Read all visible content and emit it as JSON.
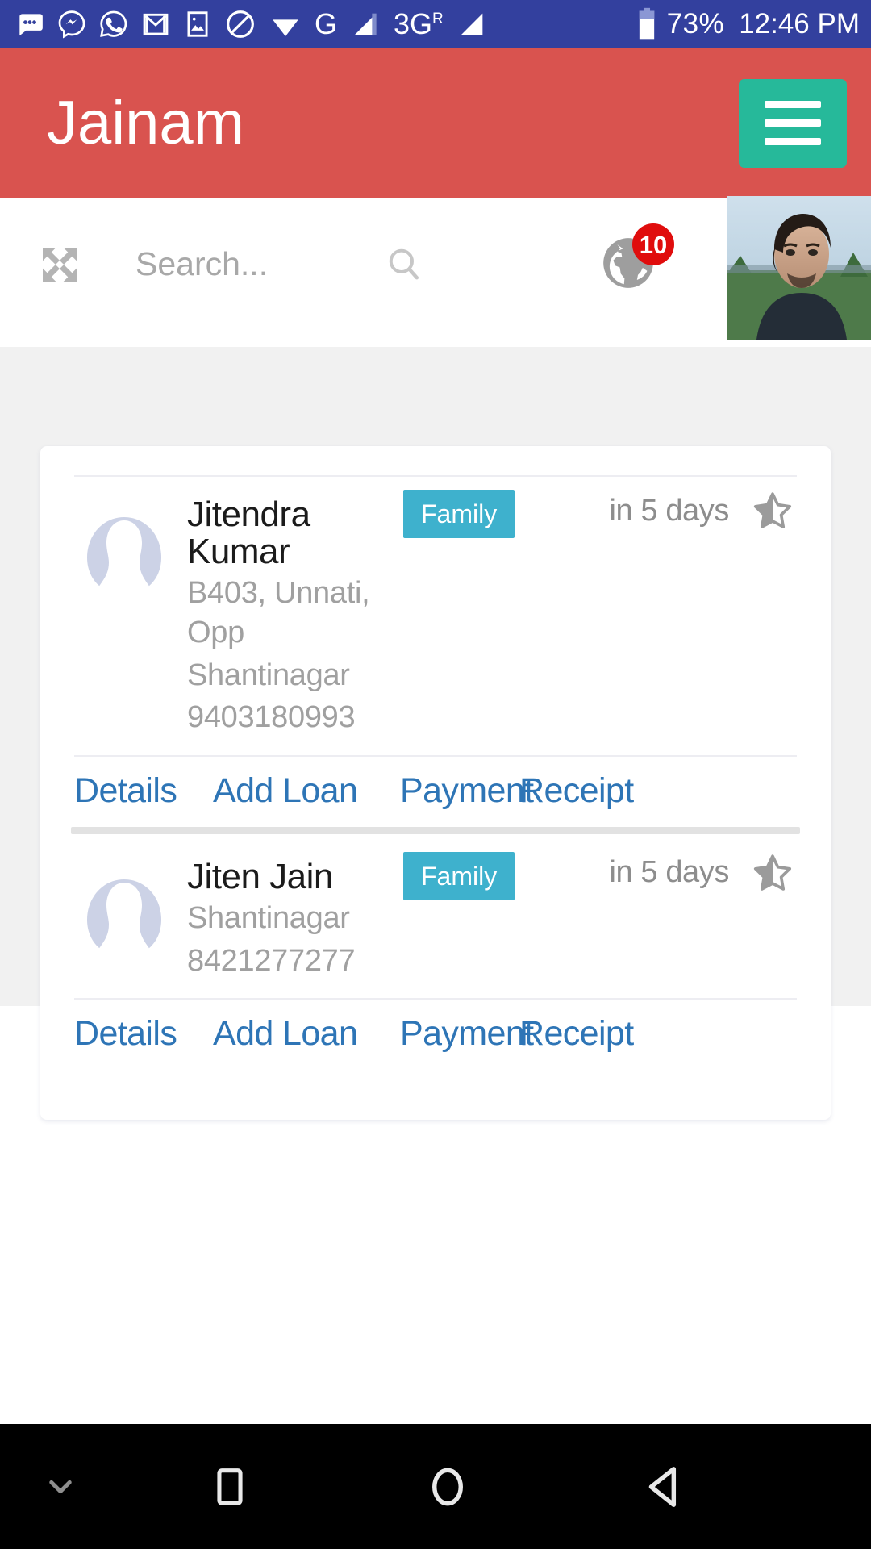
{
  "status_bar": {
    "icons": [
      "messages-icon",
      "messenger-icon",
      "whatsapp-icon",
      "gmail-icon",
      "photo-icon",
      "dnd-icon",
      "wifi-icon"
    ],
    "network_type_1": "G",
    "network_type_2": "3G",
    "network_roaming_superscript": "R",
    "battery_percent": "73%",
    "time": "12:46 PM",
    "background_color": "#33409e"
  },
  "app_bar": {
    "title": "Jainam",
    "menu_label": "menu",
    "background_color": "#d9534f",
    "menu_button_color": "#26b99a"
  },
  "search": {
    "expand_label": "expand",
    "placeholder": "Search...",
    "value": "",
    "notification_count": "10",
    "notification_badge_color": "#e00d0d",
    "avatar_label": "user profile photo"
  },
  "contacts": [
    {
      "name": "Jitendra Kumar",
      "address_line1": "B403, Unnati, Opp",
      "address_line2": "Shantinagar",
      "phone": "9403180993",
      "tag": "Family",
      "due": "in 5 days",
      "favorite_icon": "half-star-icon",
      "actions": [
        "Details",
        "Add Loan",
        "Payment",
        "Receipt"
      ]
    },
    {
      "name": "Jiten Jain",
      "address_line1": "Shantinagar",
      "address_line2": "",
      "phone": "8421277277",
      "tag": "Family",
      "due": "in 5 days",
      "favorite_icon": "half-star-icon",
      "actions": [
        "Details",
        "Add Loan",
        "Payment",
        "Receipt"
      ]
    }
  ],
  "theme": {
    "tag_color": "#3eb1cd",
    "link_color": "#2e75b6",
    "page_background": "#f1f1f1",
    "card_background": "#ffffff",
    "muted_text": "#a0a0a0"
  },
  "nav_bar": {
    "hide_keyboard_label": "hide keyboard",
    "recents_label": "recent apps",
    "home_label": "home",
    "back_label": "back",
    "background_color": "#000000"
  }
}
